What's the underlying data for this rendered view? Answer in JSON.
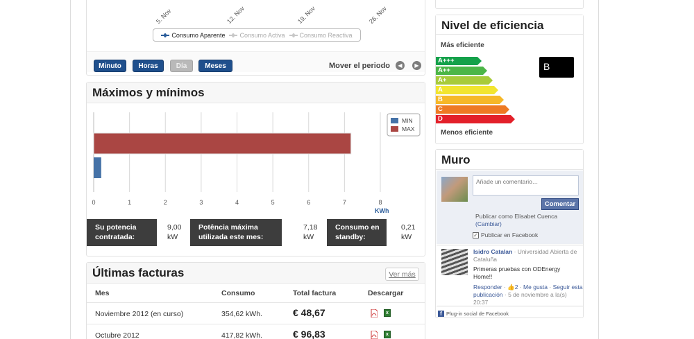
{
  "consumo_chart": {
    "x_dates": [
      "5. Nov",
      "12. Nov",
      "19. Nov",
      "26. Nov"
    ],
    "legend": [
      {
        "label": "Consumo Aparente",
        "color": "#2a5c9a",
        "active": true
      },
      {
        "label": "Consumo Activa",
        "color": "#c8c8c8",
        "active": false
      },
      {
        "label": "Consumo Reactiva",
        "color": "#c8c8c8",
        "active": false
      }
    ]
  },
  "period_buttons": [
    {
      "label": "Minuto",
      "enabled": true
    },
    {
      "label": "Horas",
      "enabled": true
    },
    {
      "label": "Día",
      "enabled": false
    },
    {
      "label": "Meses",
      "enabled": true
    }
  ],
  "mover_label": "Mover el periodo",
  "maxmin": {
    "title": "Máximos y mínimos",
    "stats": [
      {
        "label": "Su potencia contratada:",
        "value": "9,00",
        "unit": "kW"
      },
      {
        "label": "Potência máxima utilizada este mes:",
        "value": "7,18",
        "unit": "kW"
      },
      {
        "label": "Consumo en standby:",
        "value": "0,21",
        "unit": "kW"
      }
    ]
  },
  "chart_data": {
    "type": "bar",
    "orientation": "horizontal",
    "series": [
      {
        "name": "MIN",
        "color": "#4572a7",
        "values": [
          0.21
        ]
      },
      {
        "name": "MAX",
        "color": "#aa4643",
        "values": [
          7.18
        ]
      }
    ],
    "xlim": [
      0,
      8
    ],
    "x_ticks": [
      "0",
      "1",
      "2",
      "3",
      "4",
      "5",
      "6",
      "7",
      "8"
    ],
    "xlabel": "KWh",
    "grid": true,
    "legend_position": "top-right"
  },
  "facturas": {
    "title": "Últimas facturas",
    "ver_mas": "Ver más",
    "headers": [
      "Mes",
      "Consumo",
      "Total factura",
      "Descargar"
    ],
    "rows": [
      {
        "mes": "Noviembre 2012 (en curso)",
        "consumo": "354,62 kWh.",
        "total": "€ 48,67"
      },
      {
        "mes": "Octubre 2012",
        "consumo": "417,82 kWh.",
        "total": "€ 96,83"
      }
    ]
  },
  "eficiencia": {
    "title": "Nivel de eficiencia",
    "top_label": "Más eficiente",
    "bottom_label": "Menos eficiente",
    "rating": "B",
    "classes": [
      {
        "label": "A+++",
        "color": "#14a14a"
      },
      {
        "label": "A++",
        "color": "#4cb647"
      },
      {
        "label": "A+",
        "color": "#a8cb3a"
      },
      {
        "label": "A",
        "color": "#f2e52f"
      },
      {
        "label": "B",
        "color": "#f6b828"
      },
      {
        "label": "C",
        "color": "#ee7a24"
      },
      {
        "label": "D",
        "color": "#e3202a"
      }
    ]
  },
  "muro": {
    "title": "Muro",
    "placeholder": "Añade un comentario…",
    "comentar": "Comentar",
    "publicar_como": "Publicar como Elisabet Cuenca",
    "cambiar": "(Cambiar)",
    "publicar_fb": "Publicar en Facebook",
    "post": {
      "author": "Isidro Catalan",
      "affiliation": " · Universidad Abierta de Cataluña",
      "text": "Primeras pruebas con ODEnergy Home!!",
      "responder": "Responder",
      "likes": "2",
      "me_gusta": "Me gusta",
      "seguir": "Seguir esta publicación",
      "date": "5 de noviembre a la(s) 20:37"
    },
    "plugin": "Plug-in social de Facebook"
  }
}
